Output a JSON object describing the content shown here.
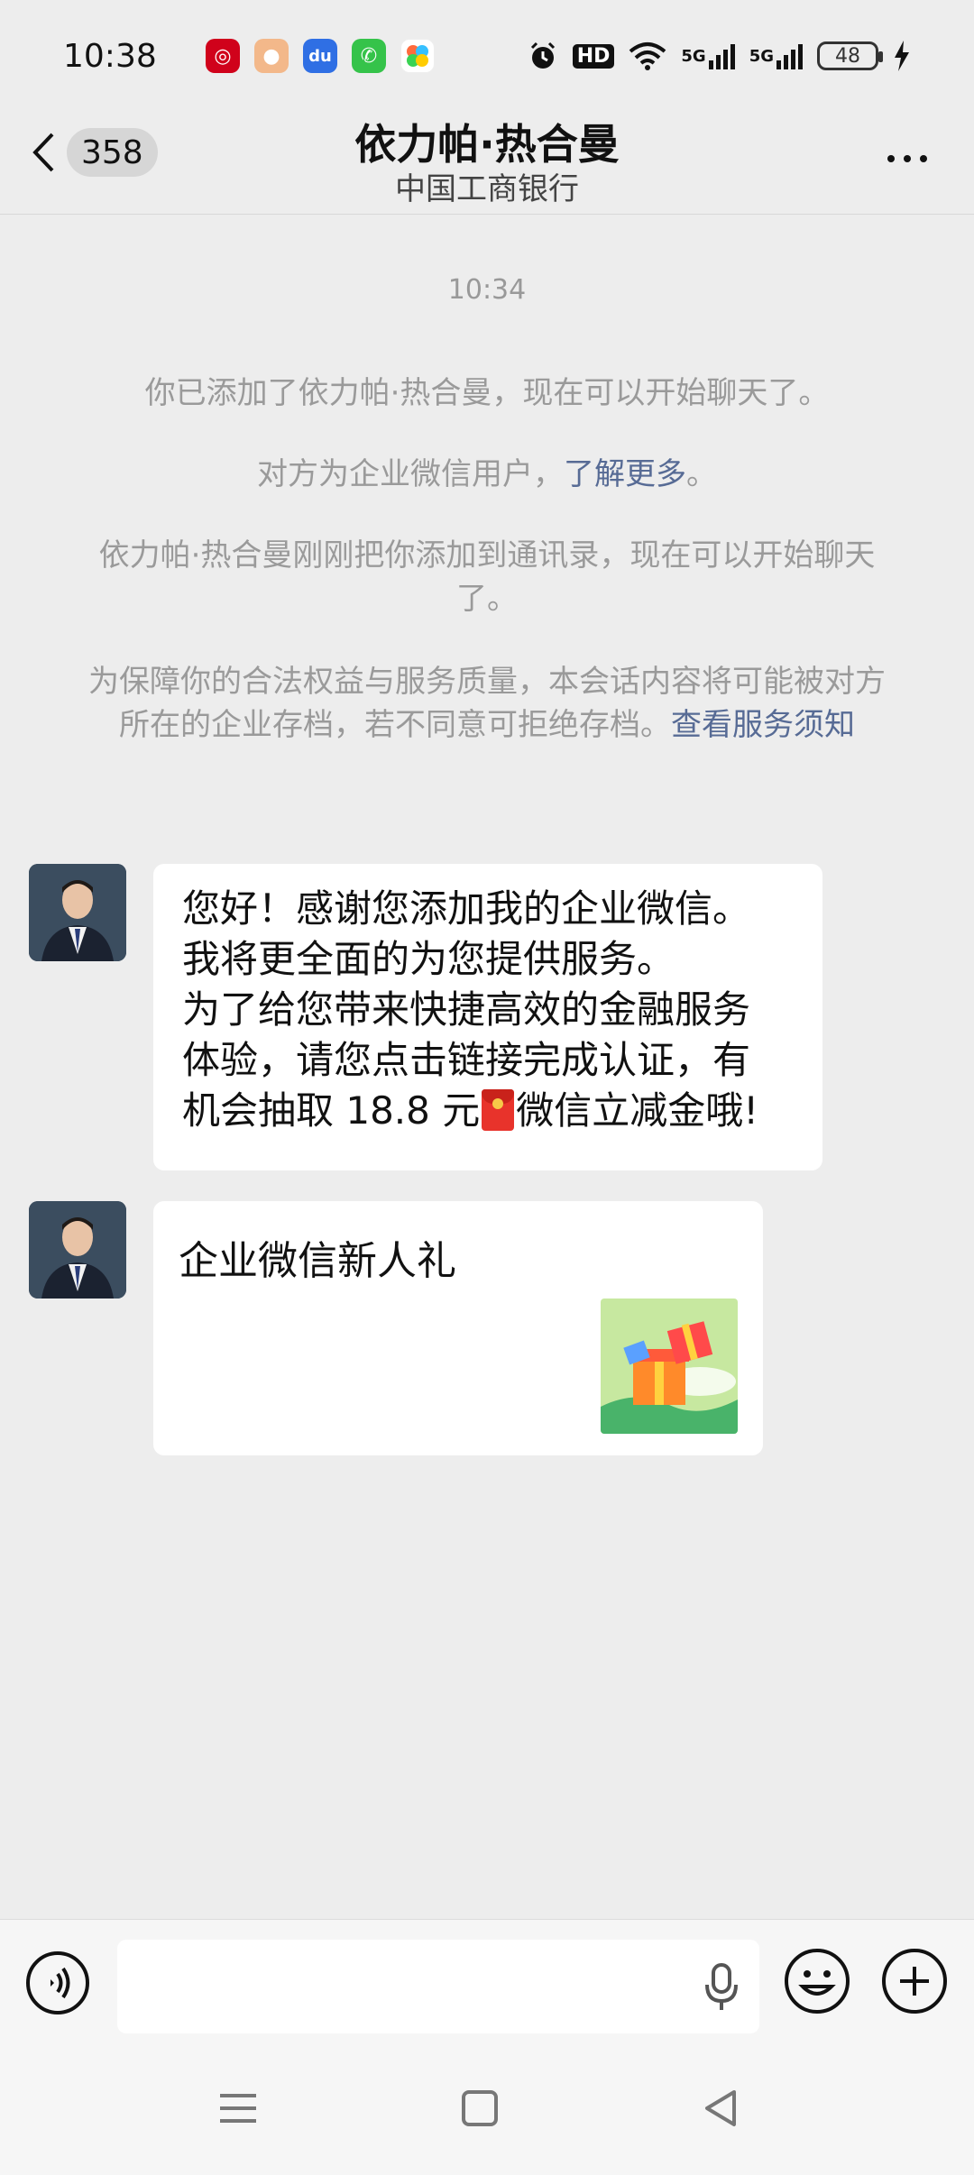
{
  "status_bar": {
    "time": "10:38",
    "apps": [
      {
        "icon": "icbc-app-icon",
        "color": "#d0021b",
        "glyph": "◎"
      },
      {
        "icon": "pet-app-icon",
        "color": "#f3b88a",
        "glyph": "●"
      },
      {
        "icon": "baidu-app-icon",
        "color": "#2f6fe4",
        "glyph": "du"
      },
      {
        "icon": "phone-app-icon",
        "color": "#35c34a",
        "glyph": "✆"
      },
      {
        "icon": "colorful-app-icon",
        "color": "#ff6b3d",
        "glyph": "✿"
      }
    ],
    "hd_label": "HD",
    "network_labels": [
      "5G",
      "5G"
    ],
    "battery": "48"
  },
  "nav": {
    "unread_count": "358",
    "title": "依力帕·热合曼",
    "subtitle": "中国工商银行"
  },
  "chat": {
    "timestamp": "10:34",
    "system_messages": {
      "added": "你已添加了依力帕·热合曼，现在可以开始聊天了。",
      "enterprise_prefix": "对方为企业微信用户，",
      "enterprise_link": "了解更多",
      "enterprise_suffix": "。",
      "contact_added": "依力帕·热合曼刚刚把你添加到通讯录，现在可以开始聊天了。",
      "archive_text": "为保障你的合法权益与服务质量，本会话内容将可能被对方所在的企业存档，若不同意可拒绝存档。",
      "archive_link": "查看服务须知"
    },
    "messages": [
      {
        "type": "text",
        "line1": "您好！感谢您添加我的企业微信。",
        "line2": "我将更全面的为您提供服务。",
        "line3": "为了给您带来快捷高效的金融服务",
        "line4": "体验，请您点击链接完成认证，有",
        "line5_prefix": "机会抽取 18.8 元",
        "line5_suffix": "微信立减金哦!"
      },
      {
        "type": "card",
        "title": "企业微信新人礼"
      }
    ]
  },
  "input_bar": {
    "placeholder": ""
  }
}
